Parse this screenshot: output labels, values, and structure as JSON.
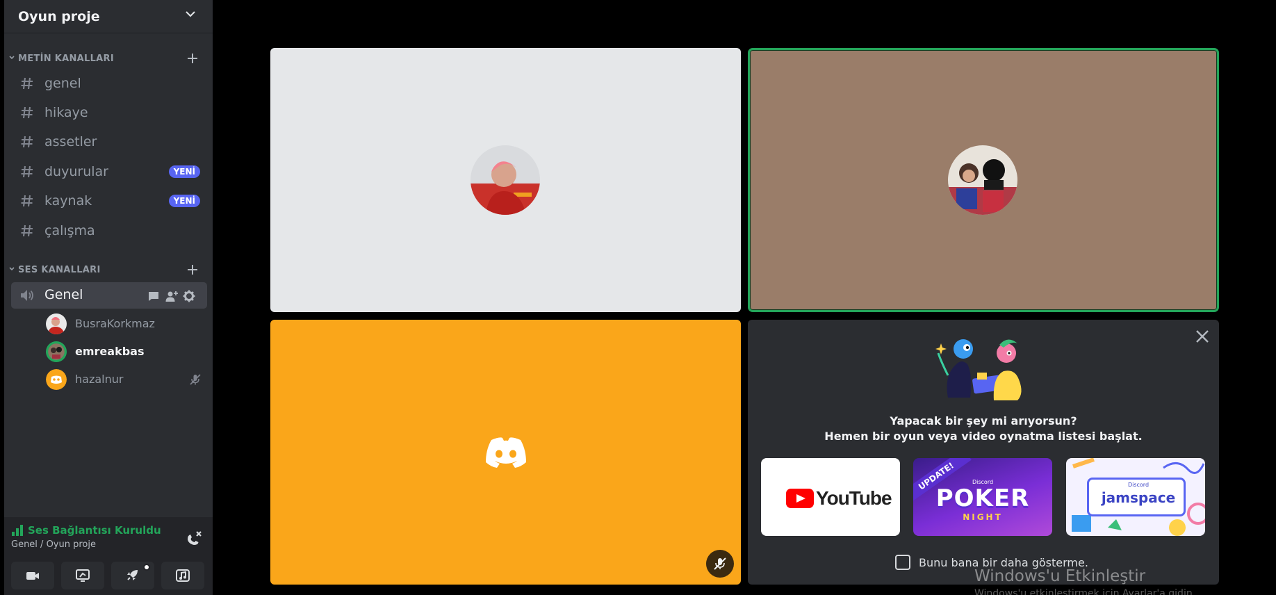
{
  "server": {
    "name": "Oyun proje"
  },
  "text_category": {
    "label": "METİN KANALLARI"
  },
  "text_channels": [
    {
      "name": "genel",
      "badge": ""
    },
    {
      "name": "hikaye",
      "badge": ""
    },
    {
      "name": "assetler",
      "badge": ""
    },
    {
      "name": "duyurular",
      "badge": "YENİ"
    },
    {
      "name": "kaynak",
      "badge": "YENİ"
    },
    {
      "name": "çalışma",
      "badge": ""
    }
  ],
  "voice_category": {
    "label": "SES KANALLARI"
  },
  "voice_channel": {
    "name": "Genel"
  },
  "voice_users": [
    {
      "name": "BusraKorkmaz",
      "speaking": false,
      "muted": false
    },
    {
      "name": "emreakbas",
      "speaking": true,
      "muted": false
    },
    {
      "name": "hazalnur",
      "speaking": false,
      "muted": true
    }
  ],
  "connection": {
    "status": "Ses Bağlantısı Kuruldu",
    "location": "Genel / Oyun proje"
  },
  "activity_panel": {
    "line1": "Yapacak bir şey mi arıyorsun?",
    "line2": "Hemen bir oyun veya video oynatma listesi başlat.",
    "cards": {
      "youtube": "YouTube",
      "poker_ribbon": "UPDATE!",
      "poker_brand": "Discord",
      "poker_title": "POKER",
      "poker_sub": "NIGHT",
      "jam_brand": "Discord",
      "jam_title": "jamspace"
    },
    "dont_show": "Bunu bana bir daha gösterme."
  },
  "watermark": {
    "title": "Windows'u Etkinleştir",
    "subtitle": "Windows'u etkinleştirmek için Ayarlar'a gidin."
  },
  "colors": {
    "sidebar_bg": "#2b2d31",
    "accent": "#5865f2",
    "speaking_green": "#23a55a",
    "tile_orange": "#faa61a",
    "tile_brown": "#9a7d69",
    "tile_light": "#e5e7e9"
  }
}
